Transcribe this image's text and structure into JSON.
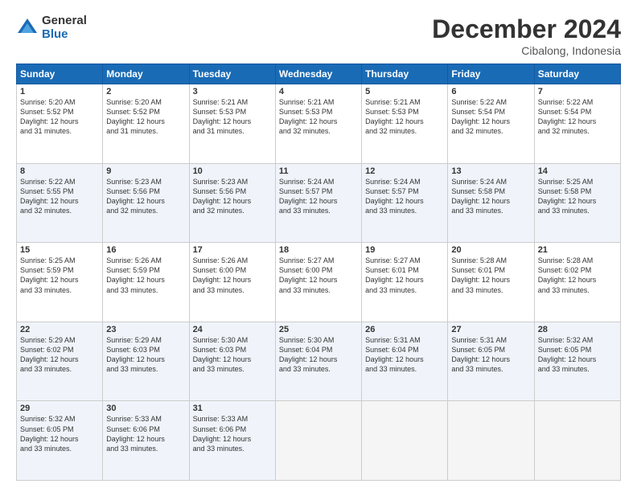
{
  "logo": {
    "general": "General",
    "blue": "Blue"
  },
  "title": "December 2024",
  "subtitle": "Cibalong, Indonesia",
  "days_header": [
    "Sunday",
    "Monday",
    "Tuesday",
    "Wednesday",
    "Thursday",
    "Friday",
    "Saturday"
  ],
  "weeks": [
    [
      {
        "day": "1",
        "info": "Sunrise: 5:20 AM\nSunset: 5:52 PM\nDaylight: 12 hours\nand 31 minutes."
      },
      {
        "day": "2",
        "info": "Sunrise: 5:20 AM\nSunset: 5:52 PM\nDaylight: 12 hours\nand 31 minutes."
      },
      {
        "day": "3",
        "info": "Sunrise: 5:21 AM\nSunset: 5:53 PM\nDaylight: 12 hours\nand 31 minutes."
      },
      {
        "day": "4",
        "info": "Sunrise: 5:21 AM\nSunset: 5:53 PM\nDaylight: 12 hours\nand 32 minutes."
      },
      {
        "day": "5",
        "info": "Sunrise: 5:21 AM\nSunset: 5:53 PM\nDaylight: 12 hours\nand 32 minutes."
      },
      {
        "day": "6",
        "info": "Sunrise: 5:22 AM\nSunset: 5:54 PM\nDaylight: 12 hours\nand 32 minutes."
      },
      {
        "day": "7",
        "info": "Sunrise: 5:22 AM\nSunset: 5:54 PM\nDaylight: 12 hours\nand 32 minutes."
      }
    ],
    [
      {
        "day": "8",
        "info": "Sunrise: 5:22 AM\nSunset: 5:55 PM\nDaylight: 12 hours\nand 32 minutes."
      },
      {
        "day": "9",
        "info": "Sunrise: 5:23 AM\nSunset: 5:56 PM\nDaylight: 12 hours\nand 32 minutes."
      },
      {
        "day": "10",
        "info": "Sunrise: 5:23 AM\nSunset: 5:56 PM\nDaylight: 12 hours\nand 32 minutes."
      },
      {
        "day": "11",
        "info": "Sunrise: 5:24 AM\nSunset: 5:57 PM\nDaylight: 12 hours\nand 33 minutes."
      },
      {
        "day": "12",
        "info": "Sunrise: 5:24 AM\nSunset: 5:57 PM\nDaylight: 12 hours\nand 33 minutes."
      },
      {
        "day": "13",
        "info": "Sunrise: 5:24 AM\nSunset: 5:58 PM\nDaylight: 12 hours\nand 33 minutes."
      },
      {
        "day": "14",
        "info": "Sunrise: 5:25 AM\nSunset: 5:58 PM\nDaylight: 12 hours\nand 33 minutes."
      }
    ],
    [
      {
        "day": "15",
        "info": "Sunrise: 5:25 AM\nSunset: 5:59 PM\nDaylight: 12 hours\nand 33 minutes."
      },
      {
        "day": "16",
        "info": "Sunrise: 5:26 AM\nSunset: 5:59 PM\nDaylight: 12 hours\nand 33 minutes."
      },
      {
        "day": "17",
        "info": "Sunrise: 5:26 AM\nSunset: 6:00 PM\nDaylight: 12 hours\nand 33 minutes."
      },
      {
        "day": "18",
        "info": "Sunrise: 5:27 AM\nSunset: 6:00 PM\nDaylight: 12 hours\nand 33 minutes."
      },
      {
        "day": "19",
        "info": "Sunrise: 5:27 AM\nSunset: 6:01 PM\nDaylight: 12 hours\nand 33 minutes."
      },
      {
        "day": "20",
        "info": "Sunrise: 5:28 AM\nSunset: 6:01 PM\nDaylight: 12 hours\nand 33 minutes."
      },
      {
        "day": "21",
        "info": "Sunrise: 5:28 AM\nSunset: 6:02 PM\nDaylight: 12 hours\nand 33 minutes."
      }
    ],
    [
      {
        "day": "22",
        "info": "Sunrise: 5:29 AM\nSunset: 6:02 PM\nDaylight: 12 hours\nand 33 minutes."
      },
      {
        "day": "23",
        "info": "Sunrise: 5:29 AM\nSunset: 6:03 PM\nDaylight: 12 hours\nand 33 minutes."
      },
      {
        "day": "24",
        "info": "Sunrise: 5:30 AM\nSunset: 6:03 PM\nDaylight: 12 hours\nand 33 minutes."
      },
      {
        "day": "25",
        "info": "Sunrise: 5:30 AM\nSunset: 6:04 PM\nDaylight: 12 hours\nand 33 minutes."
      },
      {
        "day": "26",
        "info": "Sunrise: 5:31 AM\nSunset: 6:04 PM\nDaylight: 12 hours\nand 33 minutes."
      },
      {
        "day": "27",
        "info": "Sunrise: 5:31 AM\nSunset: 6:05 PM\nDaylight: 12 hours\nand 33 minutes."
      },
      {
        "day": "28",
        "info": "Sunrise: 5:32 AM\nSunset: 6:05 PM\nDaylight: 12 hours\nand 33 minutes."
      }
    ],
    [
      {
        "day": "29",
        "info": "Sunrise: 5:32 AM\nSunset: 6:05 PM\nDaylight: 12 hours\nand 33 minutes."
      },
      {
        "day": "30",
        "info": "Sunrise: 5:33 AM\nSunset: 6:06 PM\nDaylight: 12 hours\nand 33 minutes."
      },
      {
        "day": "31",
        "info": "Sunrise: 5:33 AM\nSunset: 6:06 PM\nDaylight: 12 hours\nand 33 minutes."
      },
      null,
      null,
      null,
      null
    ]
  ]
}
